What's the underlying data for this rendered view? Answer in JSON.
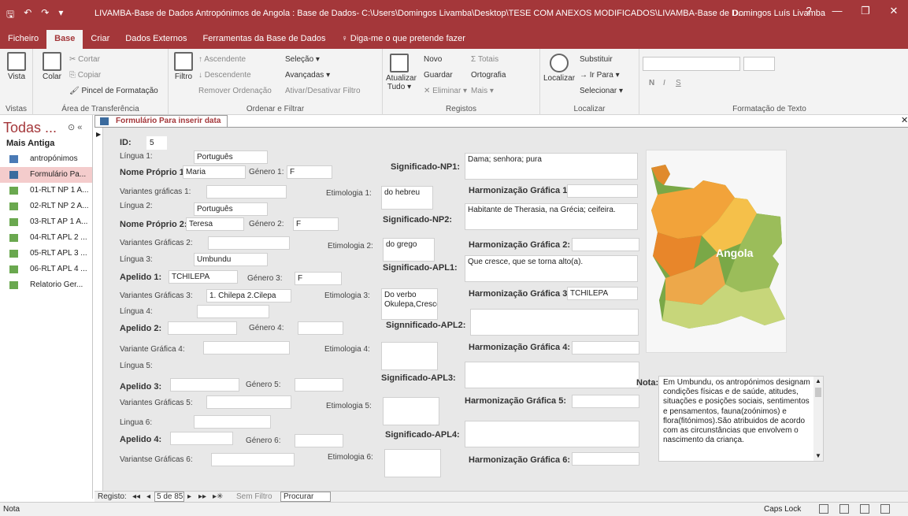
{
  "window": {
    "title": "LIVAMBA-Base de Dados Antropónimos de Angola : Base de Dados- C:\\Users\\Domingos Livamba\\Desktop\\TESE COM ANEXOS MODIFICADOS\\LIVAMBA-Base de D...",
    "user": "Domingos Luís Livamba",
    "help": "?",
    "minimize": "—",
    "restore": "❐",
    "close": "✕"
  },
  "qat": {
    "save": "🖫",
    "undo": "↶",
    "redo": "↷",
    "customize": "▾"
  },
  "tabs": [
    "Ficheiro",
    "Base",
    "Criar",
    "Dados Externos",
    "Ferramentas da Base de Dados",
    "♀ Diga-me o que pretende fazer"
  ],
  "ribbon": {
    "vistas": {
      "vista": "Vista",
      "name": "Vistas"
    },
    "clipboard": {
      "colar": "Colar",
      "cortar": "✂ Cortar",
      "copiar": "⎘ Copiar",
      "pincel": "🖌 Pincel de Formatação",
      "name": "Área de Transferência"
    },
    "sort": {
      "filtro": "Filtro",
      "asc": "↑ Ascendente",
      "desc": "↓ Descendente",
      "remover": "Remover Ordenação",
      "selecao": "Seleção ▾",
      "avancadas": "Avançadas ▾",
      "ativar": "Ativar/Desativar Filtro",
      "name": "Ordenar e Filtrar"
    },
    "records": {
      "atualizar": "Atualizar Tudo ▾",
      "novo": "Novo",
      "guardar": "Guardar",
      "eliminar": "✕ Eliminar ▾",
      "totais": "Σ Totais",
      "ortografia": "Ortografia",
      "mais": "Mais ▾",
      "name": "Registos"
    },
    "find": {
      "localizar": "Localizar",
      "substituir": "Substituir",
      "irpara": "→ Ir Para ▾",
      "selecionar": "Selecionar ▾",
      "name": "Localizar"
    },
    "format": {
      "n": "N",
      "i": "I",
      "s": "S",
      "name": "Formatação de Texto"
    }
  },
  "nav": {
    "header": "Todas ...",
    "group": "Mais Antiga",
    "items": [
      {
        "label": "antropónimos",
        "type": "table",
        "color": "#4a7ab5"
      },
      {
        "label": "Formulário Pa...",
        "type": "form",
        "color": "#3b6b9e"
      },
      {
        "label": "01-RLT NP 1 A...",
        "type": "report",
        "color": "#6aa84f"
      },
      {
        "label": "02-RLT NP 2 A...",
        "type": "report",
        "color": "#6aa84f"
      },
      {
        "label": "03-RLT AP 1 A...",
        "type": "report",
        "color": "#6aa84f"
      },
      {
        "label": "04-RLT APL 2 ...",
        "type": "report",
        "color": "#6aa84f"
      },
      {
        "label": "05-RLT APL 3 ...",
        "type": "report",
        "color": "#6aa84f"
      },
      {
        "label": "06-RLT APL 4 ...",
        "type": "report",
        "color": "#6aa84f"
      },
      {
        "label": "Relatorio Ger...",
        "type": "report",
        "color": "#6aa84f"
      }
    ]
  },
  "doc_tab": "Formulário Para inserir data",
  "form": {
    "id_label": "ID:",
    "id_value": "5",
    "lingua1_label": "Língua 1:",
    "lingua1": "Português",
    "np1_label": "Nome Próprio 1:",
    "np1": "Maria",
    "genero1_label": "Género 1:",
    "genero1": "F",
    "vg1_label": "Variantes gráficas 1:",
    "vg1": "",
    "etim1_label": "Etimologia 1:",
    "etim1": "do hebreu",
    "sig_np1_label": "Significado-NP1:",
    "sig_np1": "Dama; senhora; pura",
    "harm1_label": "Harmonização Gráfica 1",
    "harm1": "",
    "lingua2_label": "Língua 2:",
    "lingua2": "Português",
    "np2_label": "Nome Próprio 2:",
    "np2": "Teresa",
    "genero2_label": "Género 2:",
    "genero2": "F",
    "vg2_label": "Variantes Gráficas 2:",
    "vg2": "",
    "etim2_label": "Etimologia 2:",
    "etim2": "do grego",
    "sig_np2_label": "Significado-NP2:",
    "sig_np2": "Habitante de Therasia, na Grécia; ceifeira.",
    "harm2_label": "Harmonização Gráfica 2:",
    "harm2": "",
    "lingua3_label": "Língua 3:",
    "lingua3": "Umbundu",
    "ap1_label": "Apelido 1:",
    "ap1": "TCHILEPA",
    "genero3_label": "Género 3:",
    "genero3": "F",
    "vg3_label": "Variantes Gráficas 3:",
    "vg3": "1. Chilepa 2.Cilepa",
    "etim3_label": "Etimologia 3:",
    "etim3": "Do verbo Okulepa,Crescer",
    "sig_apl1_label": "Significado-APL1:",
    "sig_apl1": "Que cresce, que se torna alto(a).",
    "harm3_label": "Harmonização Gráfica 3",
    "harm3": "TCHILEPA",
    "lingua4_label": "Língua 4:",
    "lingua4": "",
    "ap2_label": "Apelido 2:",
    "ap2": "",
    "genero4_label": "Género 4:",
    "genero4": "",
    "sig_apl2_label": "Signnificado-APL2:",
    "sig_apl2": "",
    "vg4_label": "Variante Gráfica 4:",
    "vg4": "",
    "etim4_label": "Etimologia 4:",
    "etim4": "",
    "harm4_label": "Harmonização Gráfica 4:",
    "harm4": "",
    "lingua5_label": "Língua 5:",
    "lingua5": "",
    "ap3_label": "Apelido 3:",
    "ap3": "",
    "genero5_label": "Género 5:",
    "genero5": "",
    "sig_apl3_label": "Significado-APL3:",
    "sig_apl3": "",
    "vg5_label": "Variantes Gráficas 5:",
    "vg5": "",
    "etim5_label": "Etimologia 5:",
    "etim5": "",
    "harm5_label": "Harmonização Gráfica 5:",
    "harm5": "",
    "lingua6_label": "Lingua 6:",
    "lingua6": "",
    "ap4_label": "Apelido 4:",
    "ap4": "",
    "genero6_label": "Género 6:",
    "genero6": "",
    "sig_apl4_label": "Significado-APL4:",
    "sig_apl4": "",
    "vg6_label": "Variantse Gráficas 6:",
    "vg6": "",
    "etim6_label": "Etimologia 6:",
    "etim6": "",
    "harm6_label": "Harmonização Gráfica 6:",
    "harm6": "",
    "map_label": "Angola",
    "nota_label": "Nota:",
    "nota": "Em Umbundu, os antropónimos designam condições físicas e de saúde, atitudes, situações e posições sociais, sentimentos e pensamentos, fauna(zoónimos) e flora(fitónimos).São atribuidos de acordo com as circunstâncias que envolvem o nascimento da criança."
  },
  "recnav": {
    "label": "Registo:",
    "first": "◂◂",
    "prev": "◂",
    "position": "5 de 85",
    "next": "▸",
    "last": "▸▸",
    "new": "▸✳",
    "filter": "Sem Filtro",
    "search": "Procurar"
  },
  "status": {
    "left": "Nota",
    "caps": "Caps Lock"
  }
}
